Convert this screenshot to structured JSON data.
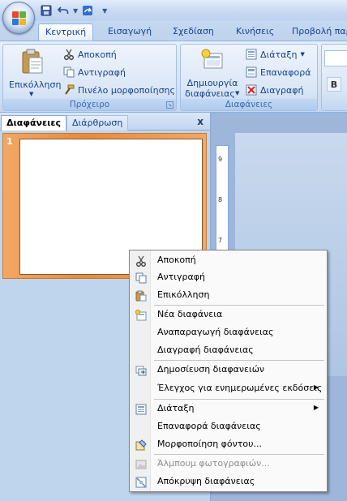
{
  "colors": {
    "ribbon_text": "#15428b",
    "group_label": "#3e6aaa",
    "thumb_selected": "#e98a3c"
  },
  "quick_access": {
    "icons": [
      "save-icon",
      "undo-icon",
      "redo-icon",
      "customize-icon"
    ]
  },
  "tabs": [
    {
      "label": "Κεντρική",
      "active": true
    },
    {
      "label": "Εισαγωγή"
    },
    {
      "label": "Σχεδίαση"
    },
    {
      "label": "Κινήσεις"
    },
    {
      "label": "Προβολή παρ"
    }
  ],
  "ribbon": {
    "clipboard": {
      "label": "Πρόχειρο",
      "paste": "Επικόλληση",
      "cut": "Αποκοπή",
      "copy": "Αντιγραφή",
      "format_painter": "Πινέλο μορφοποίησης"
    },
    "slides": {
      "label": "Διαφάνειες",
      "new_slide_line1": "Δημιουργία",
      "new_slide_line2": "διαφάνειας",
      "layout": "Διάταξη",
      "reset": "Επαναφορά",
      "delete": "Διαγραφή"
    },
    "font": {
      "bold": "B"
    }
  },
  "panel": {
    "tabs": [
      "Διαφάνειες",
      "Διάρθρωση"
    ],
    "close": "x",
    "slide_number": "1"
  },
  "ruler": {
    "marks": [
      "9",
      "8",
      "7"
    ]
  },
  "context_menu": {
    "items": [
      {
        "label": "Αποκοπή",
        "icon": "scissors-icon"
      },
      {
        "label": "Αντιγραφή",
        "icon": "copy-icon"
      },
      {
        "label": "Επικόλληση",
        "icon": "paste-icon"
      },
      {
        "label": "Νέα διαφάνεια",
        "icon": "new-slide-icon"
      },
      {
        "label": "Αναπαραγωγή διαφάνειας",
        "icon": ""
      },
      {
        "label": "Διαγραφή διαφάνειας",
        "icon": ""
      },
      {
        "label": "Δημοσίευση διαφανειών",
        "icon": "publish-icon"
      },
      {
        "label": "Έλεγχος για ενημερωμένες εκδόσεις",
        "icon": "",
        "submenu": true
      },
      {
        "label": "Διάταξη",
        "icon": "layout-icon",
        "submenu": true
      },
      {
        "label": "Επαναφορά διαφάνειας",
        "icon": ""
      },
      {
        "label": "Μορφοποίηση φόντου...",
        "icon": "format-background-icon"
      },
      {
        "label": "Άλμπουμ φωτογραφιών...",
        "icon": "photo-album-icon",
        "disabled": true
      },
      {
        "label": "Απόκρυψη διαφάνειας",
        "icon": "hide-slide-icon"
      }
    ]
  }
}
